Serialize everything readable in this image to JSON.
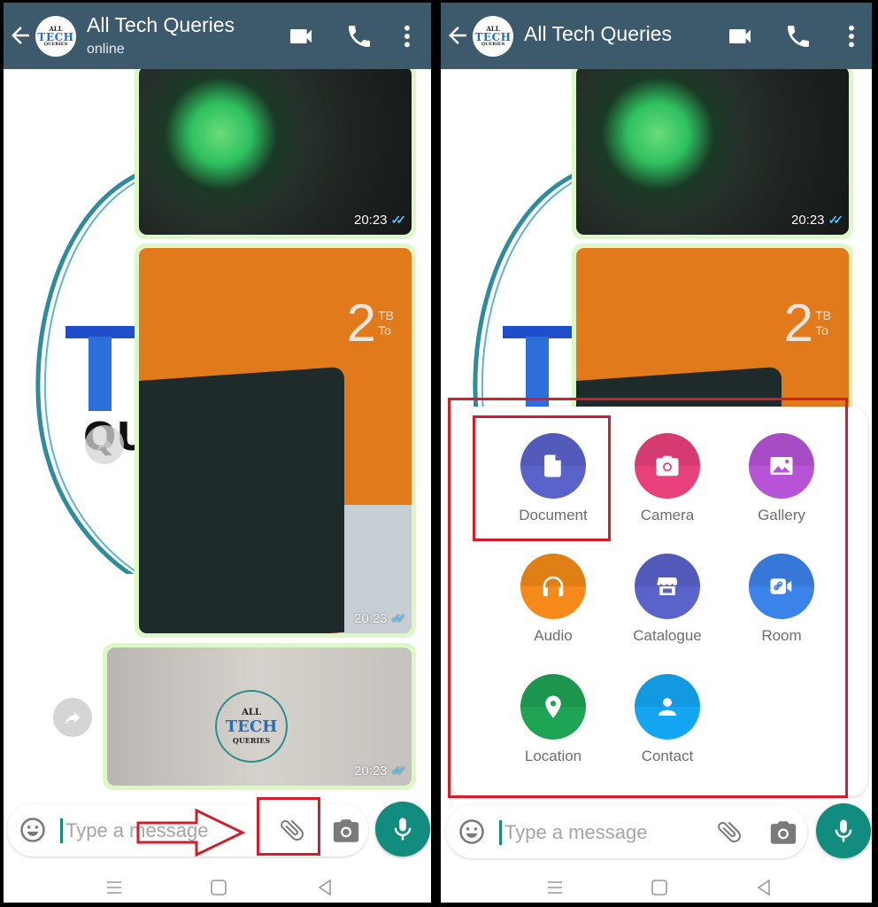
{
  "colors": {
    "header_bg": "#3d5a6c",
    "accent_green": "#128c7e",
    "bubble_bg": "#dcf8c6",
    "annotation_red": "#d11e2b",
    "read_tick_blue": "#4fc3f7"
  },
  "left_panel": {
    "header": {
      "back_icon": "arrow-left-icon",
      "avatar": {
        "line1": "ALL",
        "line2": "TECH",
        "line3": "QUERIES"
      },
      "title": "All Tech Queries",
      "status": "online",
      "icons": [
        "video-call-icon",
        "voice-call-icon",
        "more-vert-icon"
      ]
    },
    "messages": [
      {
        "type": "image",
        "description": "speaker with green RGB light",
        "time": "20:23",
        "status": "read"
      },
      {
        "type": "image",
        "description": "2TB hard drive box",
        "overlay_big": "2",
        "overlay_small1": "TB",
        "overlay_small2": "To",
        "time": "20:23",
        "status": "read"
      },
      {
        "type": "image",
        "description": "desktop screen with logo",
        "logo": {
          "line1": "ALL",
          "line2": "TECH",
          "line3": "QUERIES"
        },
        "time": "20:23",
        "status": "read"
      }
    ],
    "input": {
      "placeholder": "Type a message",
      "value": ""
    },
    "annotations": [
      "arrow pointing to attach button",
      "red box around attach button"
    ]
  },
  "right_panel": {
    "header": {
      "back_icon": "arrow-left-icon",
      "avatar": {
        "line1": "ALL",
        "line2": "TECH",
        "line3": "QUERIES"
      },
      "title": "All Tech Queries",
      "icons": [
        "video-call-icon",
        "voice-call-icon",
        "more-vert-icon"
      ]
    },
    "messages": [
      {
        "type": "image",
        "time": "20:23",
        "status": "read"
      },
      {
        "type": "image",
        "overlay_big": "2",
        "overlay_small1": "TB",
        "overlay_small2": "To"
      }
    ],
    "attach_menu": [
      {
        "label": "Document",
        "icon": "document-icon",
        "color": "#5157ae",
        "highlighted": true
      },
      {
        "label": "Camera",
        "icon": "camera-icon",
        "color": "#d3396d"
      },
      {
        "label": "Gallery",
        "icon": "gallery-icon",
        "color": "#ac44cf"
      },
      {
        "label": "Audio",
        "icon": "headphones-icon",
        "color": "#f07e0f"
      },
      {
        "label": "Catalogue",
        "icon": "storefront-icon",
        "color": "#5157ae"
      },
      {
        "label": "Room",
        "icon": "video-link-icon",
        "color": "#3478e0"
      },
      {
        "label": "Location",
        "icon": "location-pin-icon",
        "color": "#1f9d55"
      },
      {
        "label": "Contact",
        "icon": "person-icon",
        "color": "#0e9ef0"
      }
    ],
    "input": {
      "placeholder": "Type a message",
      "value": ""
    }
  },
  "system_nav": {
    "icons": [
      "menu-icon",
      "home-square-icon",
      "back-triangle-icon"
    ]
  }
}
